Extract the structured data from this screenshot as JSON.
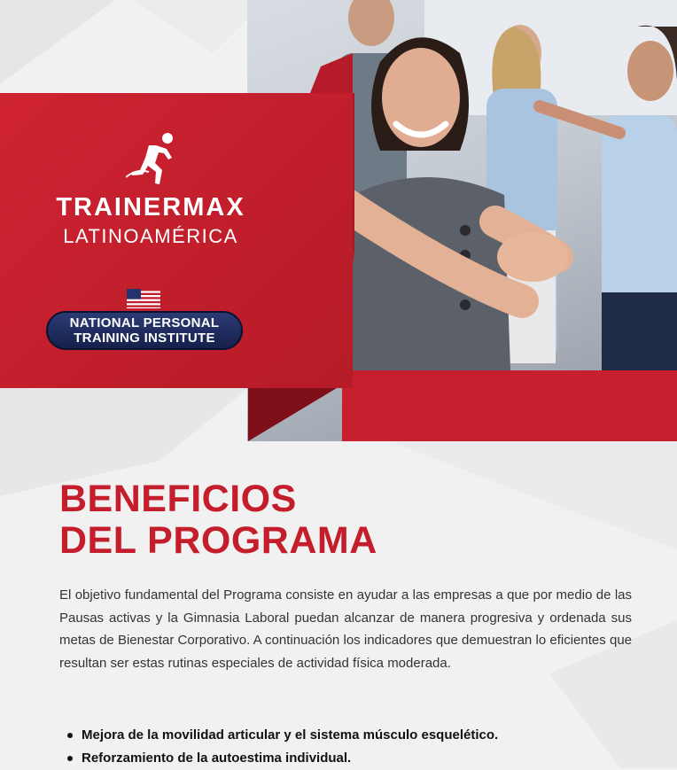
{
  "brand": {
    "name": "TRAINERMAX",
    "region": "LATINOAMÉRICA",
    "partner_line1": "NATIONAL PERSONAL",
    "partner_line2": "TRAINING INSTITUTE",
    "colors": {
      "primary_red": "#c41e2c",
      "navy": "#1c2756"
    }
  },
  "icons": {
    "logo": "runner-icon",
    "flag": "us-flag-icon"
  },
  "section": {
    "title_line1": "BENEFICIOS",
    "title_line2": "DEL PROGRAMA",
    "paragraph": "El objetivo fundamental del Programa consiste en ayudar a las empresas a que por medio de las Pausas activas y la Gimnasia Laboral puedan alcanzar de manera progresiva y ordenada sus metas de Bienestar Corporativo. A continuación los indicadores que demuestran lo eficientes que resultan ser estas rutinas especiales de actividad física moderada."
  },
  "benefits": [
    "Mejora de la movilidad articular y el sistema músculo esquelético.",
    "Reforzamiento de la autoestima individual."
  ]
}
